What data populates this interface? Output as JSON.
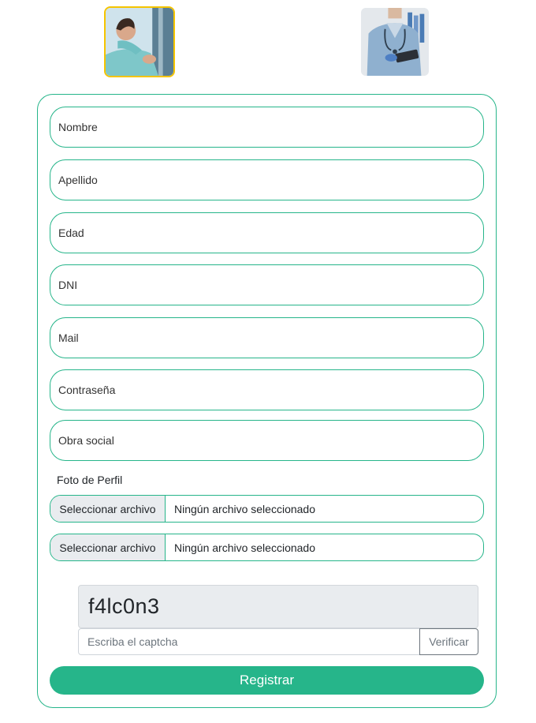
{
  "roles": {
    "patient": {
      "image": "patient-photo"
    },
    "doctor": {
      "image": "doctor-photo"
    }
  },
  "form": {
    "fields": [
      {
        "key": "nombre",
        "placeholder": "Nombre",
        "value": ""
      },
      {
        "key": "apellido",
        "placeholder": "Apellido",
        "value": ""
      },
      {
        "key": "edad",
        "placeholder": "Edad",
        "value": ""
      },
      {
        "key": "dni",
        "placeholder": "DNI",
        "value": ""
      },
      {
        "key": "mail",
        "placeholder": "Mail",
        "value": ""
      },
      {
        "key": "contrasena",
        "placeholder": "Contraseña",
        "value": ""
      },
      {
        "key": "obra_social",
        "placeholder": "Obra social",
        "value": ""
      }
    ],
    "photo_label": "Foto de Perfil",
    "files": [
      {
        "button_label": "Seleccionar archivo",
        "status": "Ningún archivo seleccionado"
      },
      {
        "button_label": "Seleccionar archivo",
        "status": "Ningún archivo seleccionado"
      }
    ],
    "captcha": {
      "code": "f4lc0n3",
      "input_placeholder": "Escriba el captcha",
      "verify_label": "Verificar"
    },
    "submit_label": "Registrar"
  },
  "colors": {
    "accent": "#26b58a",
    "selected_border": "#f5c400",
    "muted_bg": "#e9ecef"
  }
}
